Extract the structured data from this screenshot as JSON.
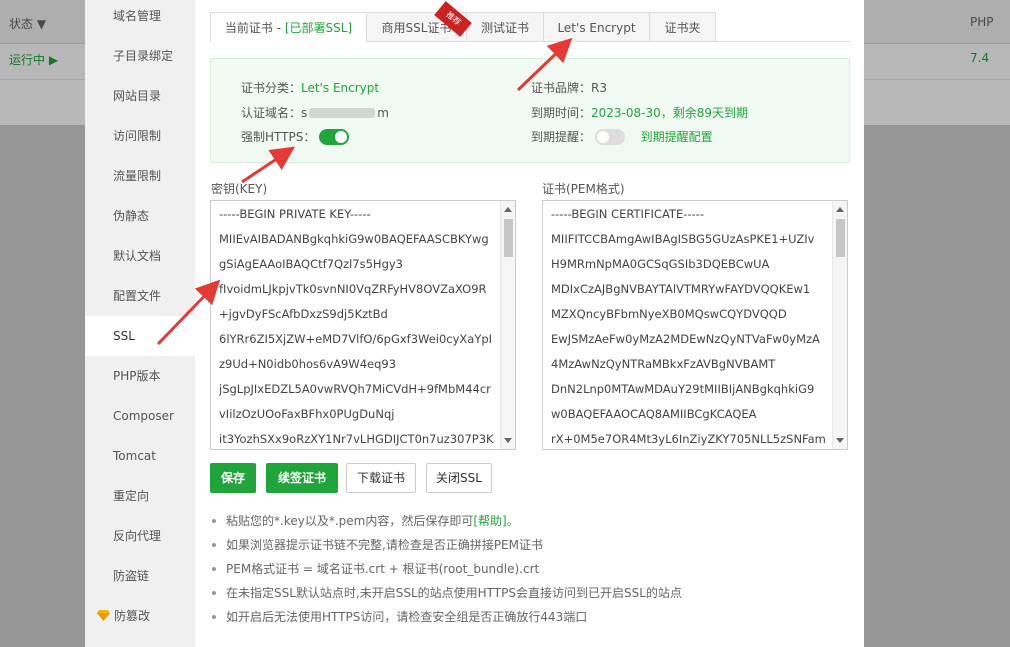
{
  "background": {
    "status_header": "状态 ▼",
    "php_header": "PHP",
    "running": "运行中 ▶",
    "php_version": "7.4"
  },
  "sidebar": {
    "items": [
      {
        "label": "域名管理"
      },
      {
        "label": "子目录绑定"
      },
      {
        "label": "网站目录"
      },
      {
        "label": "访问限制"
      },
      {
        "label": "流量限制"
      },
      {
        "label": "伪静态"
      },
      {
        "label": "默认文档"
      },
      {
        "label": "配置文件"
      },
      {
        "label": "SSL"
      },
      {
        "label": "PHP版本"
      },
      {
        "label": "Composer"
      },
      {
        "label": "Tomcat"
      },
      {
        "label": "重定向"
      },
      {
        "label": "反向代理"
      },
      {
        "label": "防盗链"
      },
      {
        "label": "防篡改"
      }
    ]
  },
  "tabs": {
    "current_prefix": "当前证书 - ",
    "current_status": "[已部署SSL]",
    "commercial": "商用SSL证书",
    "commercial_badge": "推荐",
    "test": "测试证书",
    "letsencrypt": "Let's Encrypt",
    "folder": "证书夹"
  },
  "info": {
    "category_label": "证书分类：",
    "category_value": "Let's Encrypt",
    "domain_label": "认证域名：",
    "domain_value_start": "s",
    "domain_value_end": "m",
    "https_label": "强制HTTPS：",
    "https_on": true,
    "brand_label": "证书品牌：",
    "brand_value": "R3",
    "expire_label": "到期时间：",
    "expire_value": "2023-08-30，剩余89天到期",
    "remind_label": "到期提醒：",
    "remind_on": false,
    "remind_link": "到期提醒配置"
  },
  "key": {
    "label": "密钥(KEY)",
    "lines": [
      "-----BEGIN PRIVATE KEY-----",
      "MIIEvAIBADANBgkqhkiG9w0BAQEFAASCBKYwg",
      "gSiAgEAAoIBAQCtf7Qzl7s5Hgy3",
      "fIvoidmLJkpjvTk0svnNI0VqZRFyHV8OVZaXO9R",
      "+jgvDyFScAfbDxzS9dj5KztBd",
      "6lYRr6ZI5XjZW+eMD7VlfO/6pGxf3Wei0cyXaYpI",
      "z9Ud+N0idb0hos6vA9W4eq93",
      "jSgLpJIxEDZL5A0vwRVQh7MiCVdH+9fMbM44cr",
      "vIilzOzUOoFaxBFhx0PUgDuNqj",
      "it3YozhSXx9oRzXY1Nr7vLHGDIJCT0n7uz307P3K"
    ]
  },
  "cert": {
    "label": "证书(PEM格式)",
    "lines": [
      "-----BEGIN CERTIFICATE-----",
      "MIIFITCCBAmgAwIBAgISBG5GUzAsPKE1+UZIv",
      "H9MRmNpMA0GCSqGSIb3DQEBCwUA",
      "MDIxCzAJBgNVBAYTAlVTMRYwFAYDVQQKEw1",
      "MZXQncyBFbmNyeXB0MQswCQYDVQQD",
      "EwJSMzAeFw0yMzA2MDEwNzQyNTVaFw0yMzA",
      "4MzAwNzQyNTRaMBkxFzAVBgNVBAMT",
      "DnN2Lnp0MTAwMDAuY29tMIIBIjANBgkqhkiG9",
      "w0BAQEFAAOCAQ8AMIIBCgKCAQEA",
      "rX+0M5e7OR4Mt3yL6InZiyZKY705NLL5zSNFam"
    ]
  },
  "buttons": {
    "save": "保存",
    "renew": "续签证书",
    "download": "下载证书",
    "close": "关闭SSL"
  },
  "tips": {
    "t1_text": "粘贴您的*.key以及*.pem内容，然后保存即可",
    "t1_link": "[帮助]。",
    "t2": "如果浏览器提示证书链不完整,请检查是否正确拼接PEM证书",
    "t3": "PEM格式证书 = 域名证书.crt + 根证书(root_bundle).crt",
    "t4": "在未指定SSL默认站点时,未开启SSL的站点使用HTTPS会直接访问到已开启SSL的站点",
    "t5": "如开启后无法使用HTTPS访问，请检查安全组是否正确放行443端口"
  },
  "colors": {
    "accent": "#20a53a",
    "arrow": "#e53935",
    "badge": "#cc2222"
  }
}
